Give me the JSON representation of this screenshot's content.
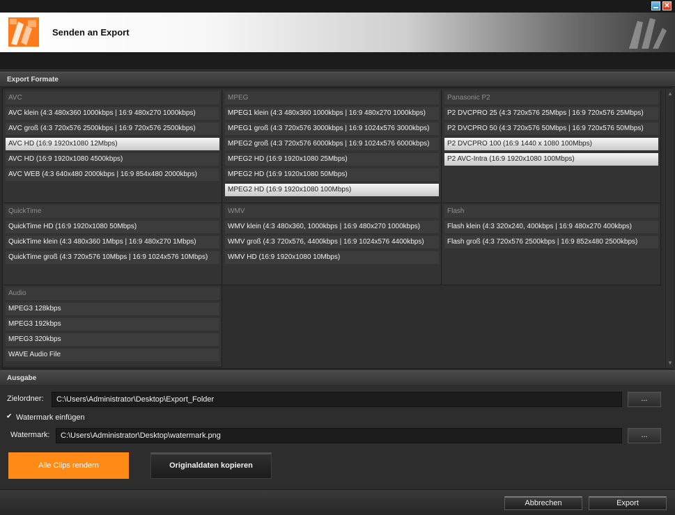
{
  "window": {
    "close_symbol": "✕"
  },
  "banner": {
    "title": "Senden an Export"
  },
  "export_formats": {
    "section_title": "Export Formate",
    "groups": [
      {
        "title": "AVC",
        "items": [
          {
            "label": "AVC klein (4:3 480x360 1000kbps | 16:9 480x270 1000kbps)"
          },
          {
            "label": "AVC groß (4:3 720x576 2500kbps | 16:9 720x576 2500kbps)"
          },
          {
            "label": "AVC HD (16:9 1920x1080 12Mbps)"
          },
          {
            "label": "AVC HD (16:9 1920x1080 4500kbps)"
          },
          {
            "label": "AVC WEB (4:3 640x480 2000kbps | 16:9 854x480 2000kbps)"
          }
        ]
      },
      {
        "title": "MPEG",
        "items": [
          {
            "label": "MPEG1 klein (4:3 480x360 1000kbps | 16:9 480x270 1000kbps)"
          },
          {
            "label": "MPEG1 groß (4:3 720x576 3000kbps | 16:9 1024x576 3000kbps)"
          },
          {
            "label": "MPEG2 groß (4:3 720x576 6000kbps | 16:9 1024x576 6000kbps)"
          },
          {
            "label": "MPEG2 HD (16:9 1920x1080 25Mbps)"
          },
          {
            "label": "MPEG2 HD (16:9 1920x1080 50Mbps)"
          },
          {
            "label": "MPEG2 HD (16:9 1920x1080 100Mbps)"
          }
        ]
      },
      {
        "title": "Panasonic P2",
        "items": [
          {
            "label": "P2 DVCPRO 25 (4:3 720x576 25Mbps | 16:9 720x576 25Mbps)"
          },
          {
            "label": "P2 DVCPRO 50 (4:3 720x576 50Mbps | 16:9 720x576 50Mbps)"
          },
          {
            "label": "P2 DVCPRO 100 (16:9 1440 x 1080 100Mbps)"
          },
          {
            "label": "P2 AVC-Intra (16:9 1920x1080 100Mbps)"
          }
        ]
      },
      {
        "title": "QuickTime",
        "items": [
          {
            "label": "QuickTime HD (16:9 1920x1080 50Mbps)"
          },
          {
            "label": "QuickTime klein (4:3 480x360 1Mbps | 16:9 480x270 1Mbps)"
          },
          {
            "label": "QuickTime groß (4:3 720x576 10Mbps | 16:9 1024x576 10Mbps)"
          }
        ]
      },
      {
        "title": "WMV",
        "items": [
          {
            "label": "WMV klein (4:3 480x360, 1000kbps | 16:9 480x270 1000kbps)"
          },
          {
            "label": "WMV groß (4:3 720x576, 4400kbps | 16:9 1024x576 4400kbps)"
          },
          {
            "label": "WMV HD (16:9 1920x1080 10Mbps)"
          }
        ]
      },
      {
        "title": "Flash",
        "items": [
          {
            "label": "Flash klein (4:3 320x240, 400kbps | 16:9 480x270 400kbps)"
          },
          {
            "label": "Flash groß (4:3 720x576 2500kbps | 16:9 852x480 2500kbps)"
          }
        ]
      },
      {
        "title": "Audio",
        "items": [
          {
            "label": "MPEG3 128kbps"
          },
          {
            "label": "MPEG3 192kbps"
          },
          {
            "label": "MPEG3 320kbps"
          },
          {
            "label": "WAVE Audio File"
          }
        ]
      }
    ],
    "selected": [
      "AVC HD (16:9 1920x1080 12Mbps)",
      "MPEG2 HD (16:9 1920x1080 100Mbps)",
      "P2 DVCPRO 100 (16:9 1440 x 1080 100Mbps)",
      "P2 AVC-Intra (16:9 1920x1080 100Mbps)"
    ]
  },
  "output": {
    "section_title": "Ausgabe",
    "target_folder_label": "Zielordner:",
    "target_folder_value": "C:\\Users\\Administrator\\Desktop\\Export_Folder",
    "browse_label": "...",
    "watermark_checkbox_label": "Watermark einfügen",
    "watermark_checked": true,
    "checkmark": "✔",
    "watermark_label": "Watermark:",
    "watermark_value": "C:\\Users\\Administrator\\Desktop\\watermark.png",
    "render_all_label": "Alle Clips rendern",
    "copy_original_label": "Originaldaten kopieren"
  },
  "footer": {
    "cancel_label": "Abbrechen",
    "export_label": "Export"
  },
  "colors": {
    "accent": "#ff8a16",
    "background": "#2b2b2b"
  },
  "icons": [
    "app-logo-icon",
    "minimize-icon",
    "close-icon",
    "checkbox-icon",
    "scroll-up-icon",
    "scroll-down-icon"
  ]
}
